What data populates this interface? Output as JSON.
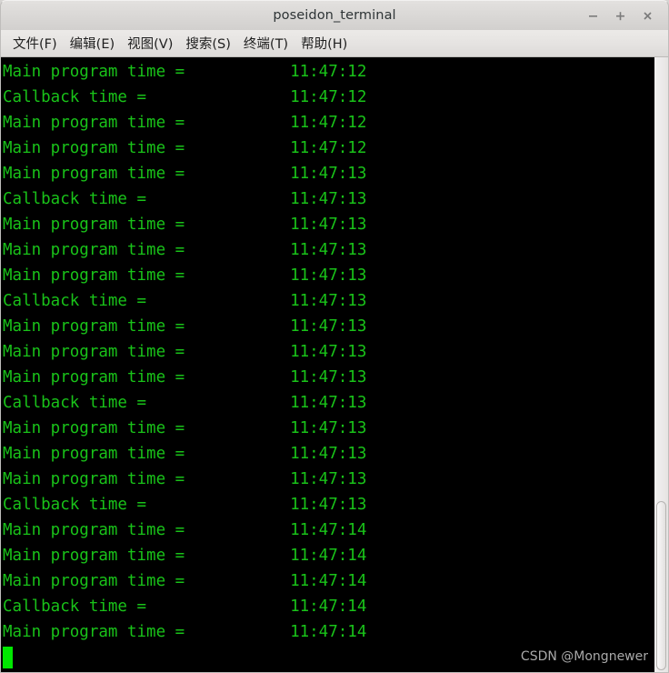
{
  "window": {
    "title": "poseidon_terminal",
    "controls": [
      {
        "name": "minimize-button",
        "glyph": "−"
      },
      {
        "name": "maximize-button",
        "glyph": "+"
      },
      {
        "name": "close-button",
        "glyph": "×"
      }
    ]
  },
  "menubar": {
    "items": [
      {
        "label": "文件(F)"
      },
      {
        "label": "编辑(E)"
      },
      {
        "label": "视图(V)"
      },
      {
        "label": "搜索(S)"
      },
      {
        "label": "终端(T)"
      },
      {
        "label": "帮助(H)"
      }
    ]
  },
  "terminal": {
    "foreground_color": "#19c219",
    "background_color": "#000000",
    "cursor_color": "#00e800",
    "lines": [
      "Main program time =           11:47:12",
      "Callback time =               11:47:12",
      "Main program time =           11:47:12",
      "Main program time =           11:47:12",
      "Main program time =           11:47:13",
      "Callback time =               11:47:13",
      "Main program time =           11:47:13",
      "Main program time =           11:47:13",
      "Main program time =           11:47:13",
      "Callback time =               11:47:13",
      "Main program time =           11:47:13",
      "Main program time =           11:47:13",
      "Main program time =           11:47:13",
      "Callback time =               11:47:13",
      "Main program time =           11:47:13",
      "Main program time =           11:47:13",
      "Main program time =           11:47:13",
      "Callback time =               11:47:13",
      "Main program time =           11:47:14",
      "Main program time =           11:47:14",
      "Main program time =           11:47:14",
      "Callback time =               11:47:14",
      "Main program time =           11:47:14"
    ]
  },
  "watermark": {
    "text": "CSDN @Mongnewer"
  }
}
